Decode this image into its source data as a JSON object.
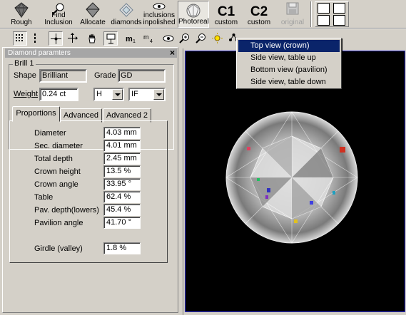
{
  "toolbar": {
    "buttons": [
      {
        "label": "Rough",
        "icon": "rough-diamond-icon"
      },
      {
        "label": "Find\nInclusion",
        "icon": "find-inclusion-magnifier-icon"
      },
      {
        "label": "Allocate",
        "icon": "allocate-diamond-icon"
      },
      {
        "label": "diamonds",
        "icon": "diamond-outline-icon"
      },
      {
        "label": "inclusions\ninpolished",
        "icon": "eye-icon"
      },
      {
        "label": "Photoreal",
        "icon": "photoreal-sphere-icon",
        "active": true
      },
      {
        "label": "custom",
        "big": "C1"
      },
      {
        "label": "custom",
        "big": "C2"
      },
      {
        "label": "original",
        "icon": "save-disk-icon",
        "disabled": true
      }
    ]
  },
  "toolbar2": {
    "icons": [
      "grid-icon",
      "dotted-line-icon",
      "move-cross-icon",
      "move-arrows-icon",
      "hand-icon",
      "projector-icon",
      "m1-icon",
      "m4-icon",
      "eye-icon",
      "zoom-in-icon",
      "zoom-out-icon",
      "light-icon",
      "view-select-icon"
    ]
  },
  "panel": {
    "title": "Diamond paramters",
    "close": "×",
    "group": "Brill 1",
    "shape_label": "Shape",
    "shape_value": "Brilliant",
    "grade_label": "Grade",
    "grade_value": "GD",
    "weight_label": "Weight",
    "weight_value": "0.24 ct",
    "color_value": "H",
    "clarity_value": "IF",
    "tabs": [
      "Proportions",
      "Advanced",
      "Advanced 2"
    ],
    "proportions": [
      {
        "label": "Diameter",
        "value": "4.03 mm"
      },
      {
        "label": "Sec. diameter",
        "value": "4.01 mm"
      },
      {
        "label": "Total depth",
        "value": "2.45 mm"
      },
      {
        "label": "Crown height",
        "value": "13.5 %"
      },
      {
        "label": "Crown angle",
        "value": "33.95 °"
      },
      {
        "label": "Table",
        "value": "62.4 %"
      },
      {
        "label": "Pav. depth(lowers)",
        "value": "45.4 %"
      },
      {
        "label": "Pavilion angle",
        "value": "41.70 °"
      }
    ],
    "girdle_label": "Girdle (valley)",
    "girdle_value": "1.8 %"
  },
  "menu": {
    "items": [
      "Top view (crown)",
      "Side view, table up",
      "Bottom view (pavilion)",
      "Side view, table down"
    ],
    "selected_index": 0
  },
  "colors": {
    "face": "#d4d0c8",
    "menu_highlight": "#0a246a",
    "view_background": "#000000",
    "view_border": "#3030d0"
  }
}
